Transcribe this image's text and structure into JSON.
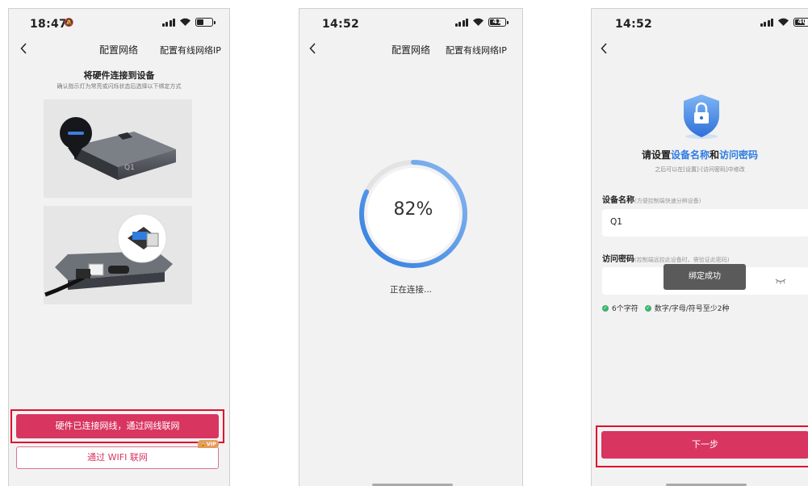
{
  "screen1": {
    "status": {
      "time": "18:47"
    },
    "nav": {
      "title": "配置网络",
      "right_link": "配置有线网络IP"
    },
    "heading": "将硬件连接到设备",
    "subheading": "确认指示灯为常亮或闪烁状态后选择以下绑定方式",
    "device_label": "Q1",
    "primary_button": "硬件已连接网线，通过网线联网",
    "secondary_button": "通过 WIFI 联网",
    "vip_badge": "VIP"
  },
  "screen2": {
    "status": {
      "time": "14:52",
      "battery": "41"
    },
    "nav": {
      "title": "配置网络",
      "right_link": "配置有线网络IP"
    },
    "progress": {
      "percent_label": "82%",
      "value": 0.82
    },
    "status_text": "正在连接..."
  },
  "screen3": {
    "status": {
      "time": "14:52",
      "battery": "40"
    },
    "title_pre": "请设置",
    "title_em1": "设备名称",
    "title_mid": "和",
    "title_em2": "访问密码",
    "subtitle": "之后可以在[设置]-[访问密码]中修改",
    "name_label": "设备名称",
    "name_hint": "(方便控制端快速分辨设备)",
    "name_value": "Q1",
    "pwd_label": "访问密码",
    "pwd_hint": "(控制端远控此设备时，需验证此密码)",
    "toast": "绑定成功",
    "rule1": "6个字符",
    "rule2": "数字/字母/符号至少2种",
    "next_button": "下一步"
  },
  "colors": {
    "accent": "#d83560",
    "blue": "#2f7de1",
    "green": "#3cb46e",
    "highlight_box": "#e0102c"
  }
}
